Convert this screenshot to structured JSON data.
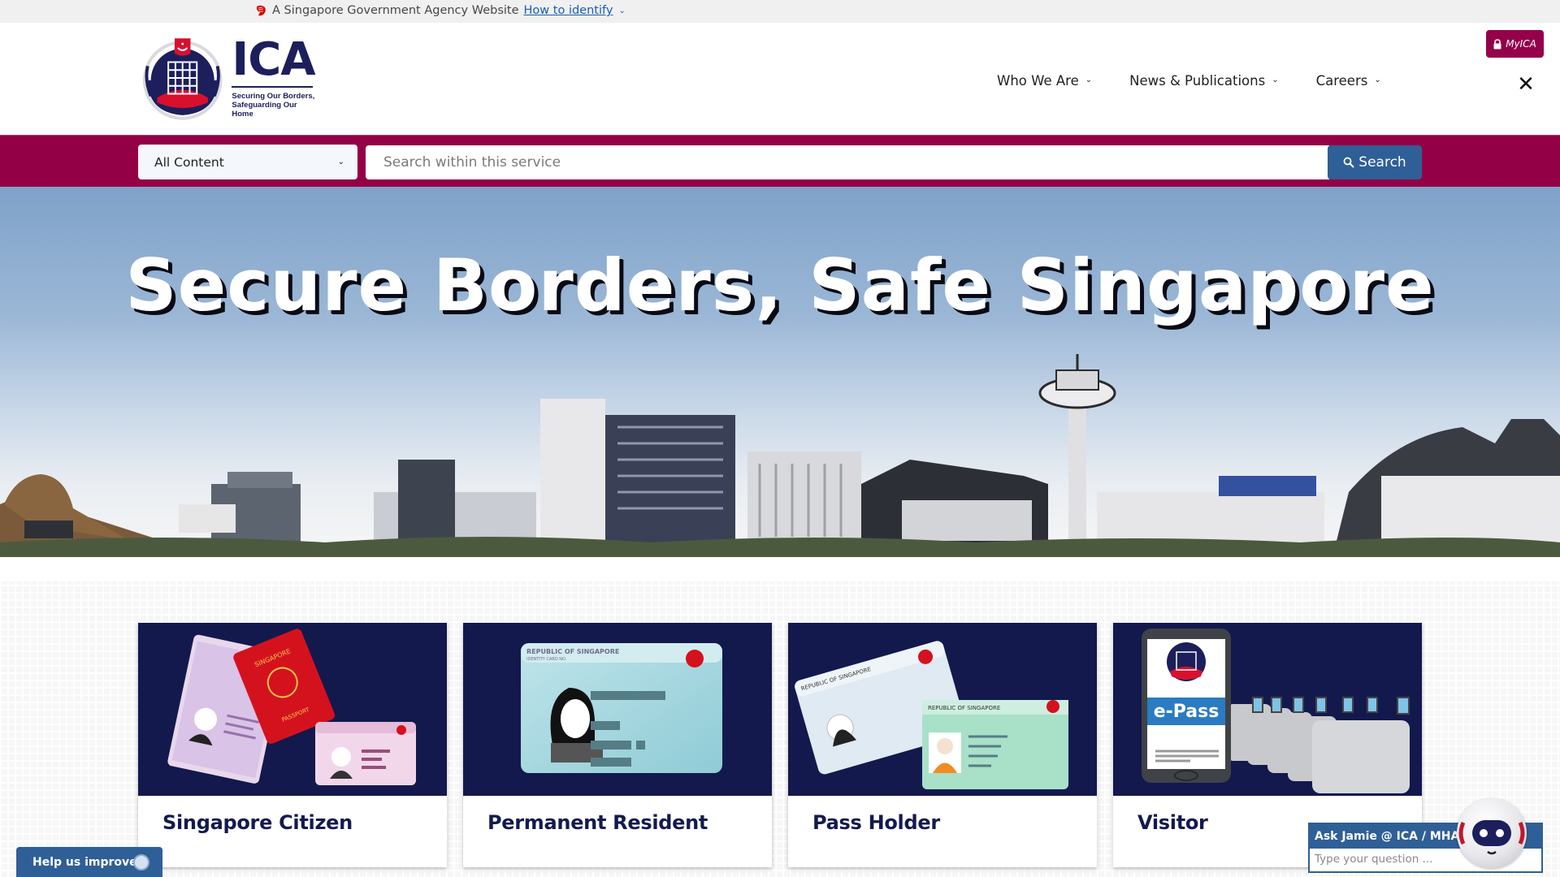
{
  "masthead": {
    "text": "A Singapore Government Agency Website",
    "link_label": "How to identify"
  },
  "header": {
    "logo_wordmark": "ICA",
    "logo_tagline_1": "Securing Our Borders,",
    "logo_tagline_2": "Safeguarding Our Home",
    "nav": [
      {
        "label": "Who We Are"
      },
      {
        "label": "News & Publications"
      },
      {
        "label": "Careers"
      }
    ],
    "myica_label": "MyICA",
    "close_symbol": "✕"
  },
  "search": {
    "scope_selected": "All Content",
    "placeholder": "Search within this service",
    "value": "",
    "button_label": "Search"
  },
  "hero": {
    "title": "Secure Borders, Safe Singapore"
  },
  "cards": [
    {
      "title": "Singapore Citizen",
      "image": "passport-and-ic-illustration"
    },
    {
      "title": "Permanent Resident",
      "image": "identity-card-illustration"
    },
    {
      "title": "Pass Holder",
      "image": "pass-cards-illustration"
    },
    {
      "title": "Visitor",
      "image": "e-pass-gates-illustration"
    }
  ],
  "feedback": {
    "label": "Help us improve"
  },
  "chat": {
    "title": "Ask Jamie @ ICA / MHA",
    "placeholder": "Type your question ..."
  },
  "colors": {
    "brand_magenta": "#930045",
    "navy": "#13194d",
    "button_blue": "#2f5f97"
  }
}
